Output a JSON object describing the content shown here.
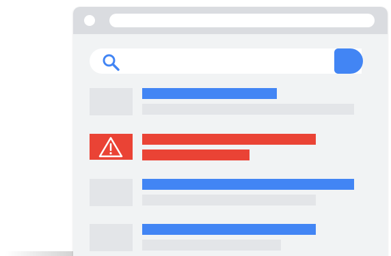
{
  "theme": {
    "accent": "#4285f4",
    "warning": "#ea4335",
    "chrome": "#dadce0",
    "page_bg": "#f1f3f4",
    "placeholder": "#e3e5e8"
  },
  "browser": {
    "window_controls": [
      "circle-button"
    ],
    "address_bar": ""
  },
  "search": {
    "icon": "search-icon",
    "button_color": "#4285f4"
  },
  "results": [
    {
      "thumbnail": "placeholder",
      "title_color": "blue",
      "state": "normal"
    },
    {
      "thumbnail": "warning-icon",
      "title_color": "red",
      "state": "flagged"
    },
    {
      "thumbnail": "placeholder",
      "title_color": "blue",
      "state": "normal"
    },
    {
      "thumbnail": "placeholder",
      "title_color": "blue",
      "state": "normal"
    }
  ]
}
